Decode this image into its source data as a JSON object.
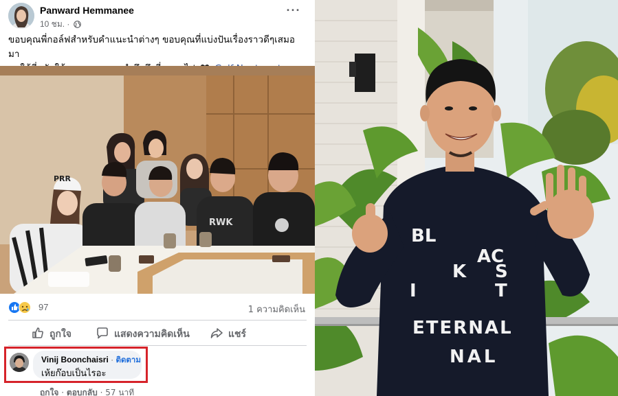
{
  "post": {
    "author_name": "Panward Hemmanee",
    "timestamp": "10 ชม.",
    "separator": "·",
    "text_line1": "ขอบคุณพี่กอล์ฟสำหรับคำแนะนำต่างๆ ขอบคุณที่แบ่งปันเรื่องราวดีๆเสมอมา",
    "text_line2": "ขอให้พี่หลับให้สบายนะคะ จะรำลึกถึงพี่ตลอดไป",
    "tagged_person": "Golf Nuntawat",
    "more_options": "···"
  },
  "reactions": {
    "count": "97",
    "comments": "1 ความคิดเห็น",
    "types": [
      "like-icon",
      "sad-icon"
    ]
  },
  "actions": {
    "like_label": "ถูกใจ",
    "comment_label": "แสดงความคิดเห็น",
    "share_label": "แชร์"
  },
  "comment": {
    "author": "Vinij Boonchaisri",
    "dot": "·",
    "follow_label": "ติดตาม",
    "text": "เห้ยก๊อบเป็นไรอะ",
    "like_label": "ถูกใจ",
    "reply_label": "ตอบกลับ",
    "time": "57 นาที"
  },
  "photo_right": {
    "shirt_text": {
      "row1": "BL",
      "row1b": "AC",
      "row2": "K",
      "row2b": "S",
      "row3": "I",
      "row3b": "T",
      "row4": "ETERNAL",
      "row5": "NAL"
    }
  },
  "colors": {
    "highlight_border": "#d6232a",
    "link_blue": "#385898",
    "follow_blue": "#216fdb",
    "muted_text": "#65676b"
  }
}
